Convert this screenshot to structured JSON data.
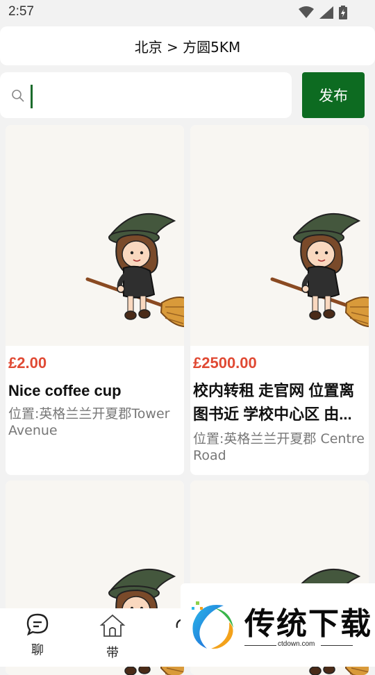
{
  "status_bar": {
    "time": "2:57",
    "icons": [
      "wifi-icon",
      "signal-icon",
      "battery-icon"
    ]
  },
  "location": {
    "label": "北京 > 方圆5KM"
  },
  "search": {
    "value": "",
    "placeholder": "",
    "icon": "search-icon"
  },
  "publish_button": {
    "label": "发布"
  },
  "colors": {
    "accent": "#0d6b21",
    "price": "#e04a34",
    "background": "#f2f2f2"
  },
  "listings": [
    {
      "price": "£2.00",
      "title": "Nice coffee cup",
      "location": "位置:英格兰兰开夏郡Tower Avenue",
      "image": "witch-on-broom-illustration"
    },
    {
      "price": "£2500.00",
      "title": "校内转租 走官网 位置离图书近 学校中心区 由...",
      "location": "位置:英格兰兰开夏郡 Centre Road",
      "image": "witch-on-broom-illustration"
    },
    {
      "image": "witch-on-broom-illustration"
    },
    {
      "image": "witch-on-broom-illustration"
    }
  ],
  "bottom_nav": [
    {
      "label": "聊",
      "icon": "chat-icon"
    },
    {
      "label": "带",
      "icon": "home-icon"
    },
    {
      "icon": "partial-icon"
    }
  ],
  "watermark": {
    "title": "传统下载",
    "url": "ctdown.com"
  }
}
